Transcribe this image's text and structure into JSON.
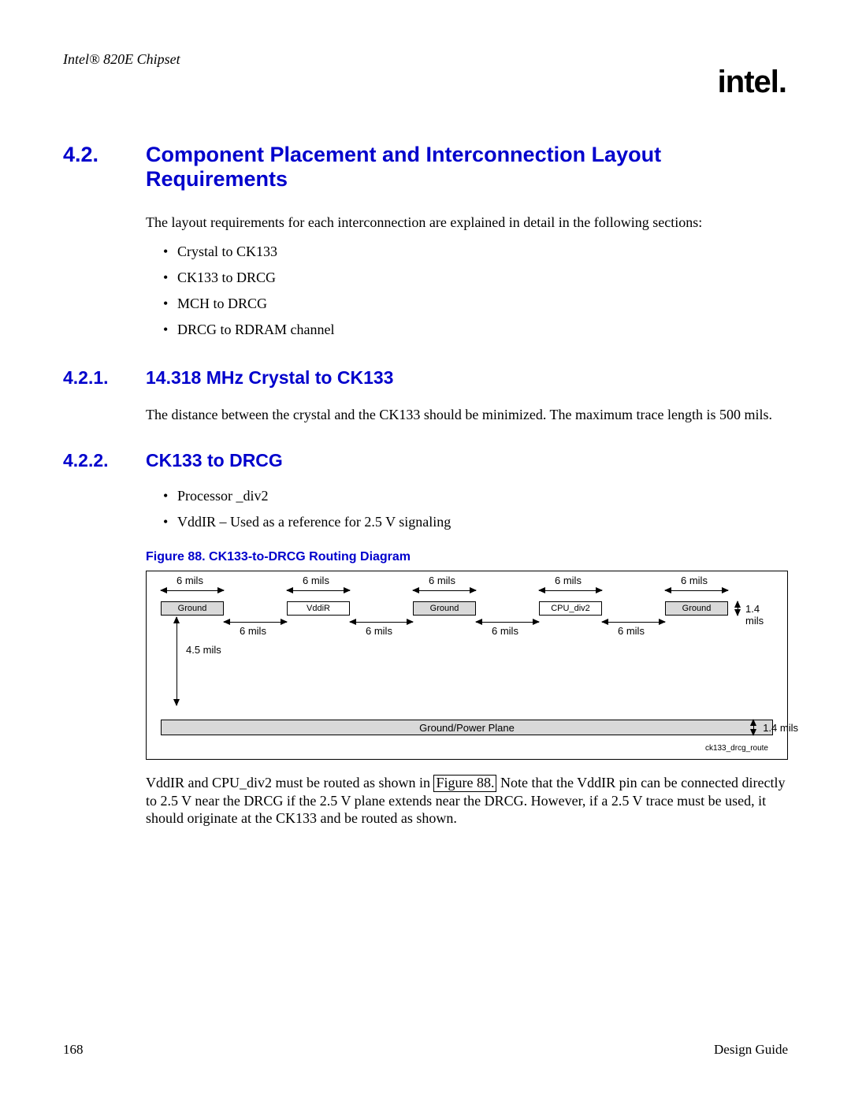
{
  "header": {
    "running": "Intel® 820E Chipset",
    "logo": "intel",
    "logo_dot": "."
  },
  "section": {
    "num": "4.2.",
    "title": "Component Placement and Interconnection Layout Requirements",
    "intro": "The layout requirements for each interconnection are explained in detail in the following sections:",
    "bullets": [
      "Crystal to CK133",
      "CK133 to DRCG",
      "MCH to DRCG",
      "DRCG to RDRAM channel"
    ]
  },
  "sub1": {
    "num": "4.2.1.",
    "title": "14.318 MHz Crystal to CK133",
    "para": "The distance between the crystal and the CK133 should be minimized. The maximum trace length is 500 mils."
  },
  "sub2": {
    "num": "4.2.2.",
    "title": "CK133 to DRCG",
    "bullets": [
      "Processor _div2",
      "VddIR – Used as a reference for 2.5 V signaling"
    ]
  },
  "figure": {
    "caption": "Figure 88. CK133-to-DRCG Routing Diagram",
    "top_dims": [
      "6 mils",
      "6 mils",
      "6 mils",
      "6 mils",
      "6 mils"
    ],
    "traces": [
      "Ground",
      "VddiR",
      "Ground",
      "CPU_div2",
      "Ground"
    ],
    "gap_dims": [
      "6 mils",
      "6 mils",
      "6 mils",
      "6 mils"
    ],
    "right_dim_trace": "1.4 mils",
    "left_dim_depth": "4.5 mils",
    "plane": "Ground/Power Plane",
    "right_dim_plane": "1.4 mils",
    "id": "ck133_drcg_route"
  },
  "closing": {
    "pre": "VddIR and CPU_div2 must be routed as shown in ",
    "link": "Figure 88.",
    "post": " Note that the VddIR pin can be connected directly to 2.5 V near the DRCG if the 2.5 V plane extends near the DRCG. However, if a 2.5 V trace must be used, it should originate at the CK133 and be routed as shown."
  },
  "footer": {
    "page": "168",
    "doc": "Design Guide"
  }
}
